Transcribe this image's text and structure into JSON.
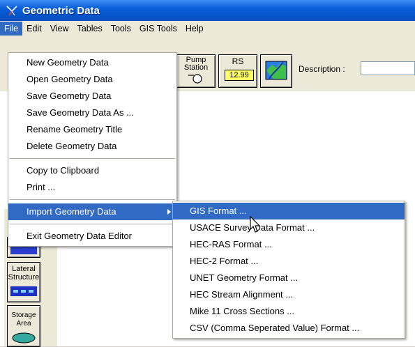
{
  "window": {
    "title": "Geometric Data"
  },
  "menubar": [
    "File",
    "Edit",
    "View",
    "Tables",
    "Tools",
    "GIS Tools",
    "Help"
  ],
  "toolbar": {
    "pump_station_label": [
      "Pump",
      "Station"
    ],
    "rs_label": "RS",
    "rs_value": "12.99",
    "description_label": "Description :",
    "description_value": ""
  },
  "left_tools": {
    "lateral_structure_label": [
      "Lateral",
      "Structure"
    ],
    "storage_area_label": [
      "Storage",
      "Area"
    ]
  },
  "file_menu": {
    "items": [
      "New Geometry Data",
      "Open Geometry Data",
      "Save Geometry Data",
      "Save Geometry Data As ...",
      "Rename Geometry Title",
      "Delete Geometry Data",
      "Copy to Clipboard",
      "Print ...",
      "Import Geometry Data",
      "Exit Geometry Data Editor"
    ]
  },
  "import_submenu": {
    "items": [
      "GIS Format ...",
      "USACE Survey Data Format ...",
      "HEC-RAS Format ...",
      "HEC-2 Format ...",
      "UNET Geometry Format ...",
      "HEC Stream Alignment ...",
      "Mike 11 Cross Sections ...",
      "CSV (Comma Seperated Value) Format ..."
    ]
  },
  "colors": {
    "title_bar": "#0453c8",
    "highlight": "#316ac5",
    "menu_bg": "#ffffff",
    "chrome": "#ece9d8"
  }
}
